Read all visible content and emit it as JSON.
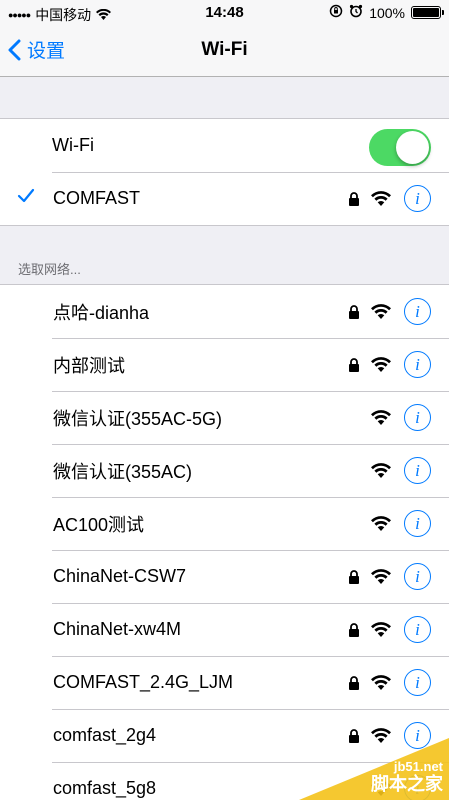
{
  "status_bar": {
    "carrier": "中国移动",
    "time": "14:48",
    "battery": "100%",
    "battery_level": 1.0
  },
  "nav": {
    "back_label": "设置",
    "title": "Wi-Fi"
  },
  "wifi_toggle": {
    "label": "Wi-Fi",
    "on": true,
    "on_color": "#4cd964"
  },
  "connected": {
    "name": "COMFAST",
    "secured": true
  },
  "section_header": "选取网络...",
  "networks": [
    {
      "name": "点哈-dianha",
      "secured": true
    },
    {
      "name": "内部测试",
      "secured": true
    },
    {
      "name": "微信认证(355AC-5G)",
      "secured": false
    },
    {
      "name": "微信认证(355AC)",
      "secured": false
    },
    {
      "name": "AC100测试",
      "secured": false
    },
    {
      "name": "ChinaNet-CSW7",
      "secured": true
    },
    {
      "name": "ChinaNet-xw4M",
      "secured": true
    },
    {
      "name": "COMFAST_2.4G_LJM",
      "secured": true
    },
    {
      "name": "comfast_2g4",
      "secured": true
    },
    {
      "name": "comfast_5g8",
      "secured": false
    }
  ],
  "watermark": {
    "url": "jb51.net",
    "name": "脚本之家"
  },
  "colors": {
    "accent": "#007aff",
    "watermark": "#f4c21a"
  }
}
